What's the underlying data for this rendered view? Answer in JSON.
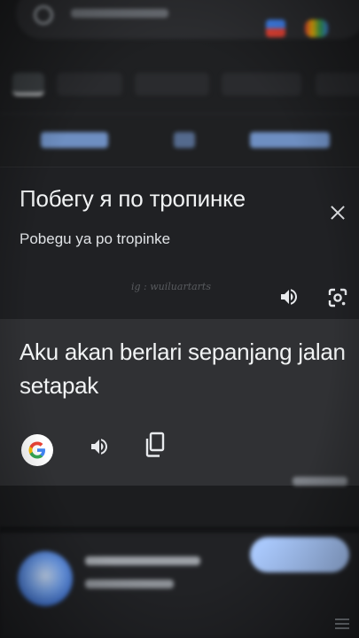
{
  "translation": {
    "source_text": "Побегу я по тропинке",
    "transliteration": "Pobegu ya po tropinke",
    "translated_text": "Aku akan berlari sepanjang jalan setapak"
  },
  "watermark": "ig : wuiluartarts",
  "icons": {
    "close": "close-icon",
    "speaker": "volume-icon",
    "camera": "lens-camera-icon",
    "google": "google-g-icon",
    "copy": "copy-icon"
  },
  "colors": {
    "background": "#202124",
    "translation_panel": "#303134",
    "text": "#f1f3f4",
    "google_blue": "#4285f4",
    "google_red": "#ea4335",
    "google_yellow": "#fbbc05",
    "google_green": "#34a853"
  }
}
